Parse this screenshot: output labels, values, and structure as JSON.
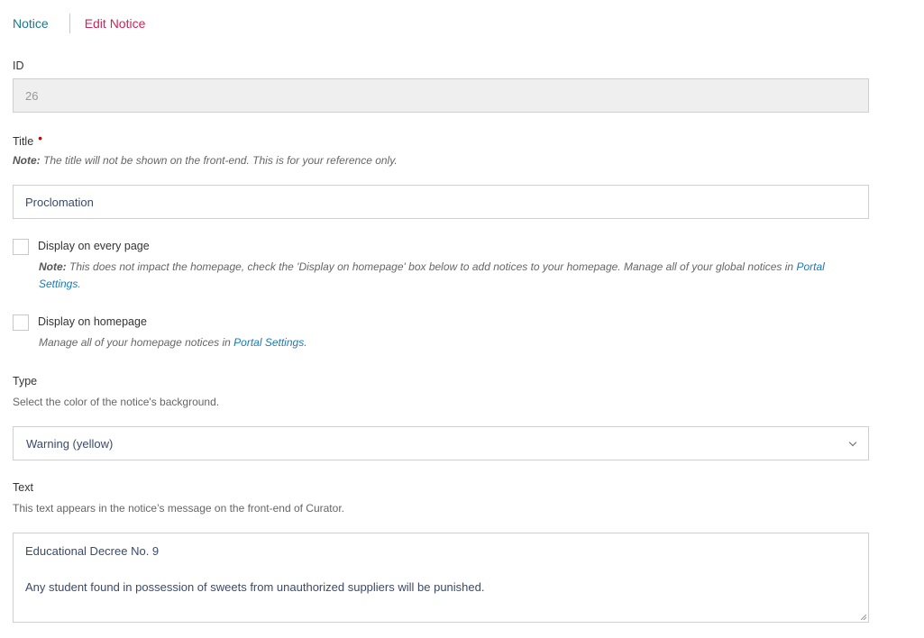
{
  "breadcrumb": {
    "parent": "Notice",
    "current": "Edit Notice"
  },
  "id_field": {
    "label": "ID",
    "value": "26"
  },
  "title_field": {
    "label": "Title",
    "required_marker": "•",
    "note_prefix": "Note:",
    "note_text": "The title will not be shown on the front-end. This is for your reference only.",
    "value": "Proclomation"
  },
  "display_every_page": {
    "label": "Display on every page",
    "checked": false,
    "note_prefix": "Note:",
    "note_text": "This does not impact the homepage, check the 'Display on homepage' box below to add notices to your homepage. Manage all of your global notices in",
    "note_link": "Portal Settings",
    "note_suffix": "."
  },
  "display_homepage": {
    "label": "Display on homepage",
    "checked": false,
    "note_text": "Manage all of your homepage notices in",
    "note_link": "Portal Settings",
    "note_suffix": "."
  },
  "type_field": {
    "label": "Type",
    "help": "Select the color of the notice's background.",
    "selected": "Warning (yellow)"
  },
  "text_field": {
    "label": "Text",
    "help": "This text appears in the notice’s message on the front-end of Curator.",
    "line1": "Educational Decree No. 9",
    "line2": "Any student found in possession of sweets from unauthorized suppliers will be punished."
  }
}
